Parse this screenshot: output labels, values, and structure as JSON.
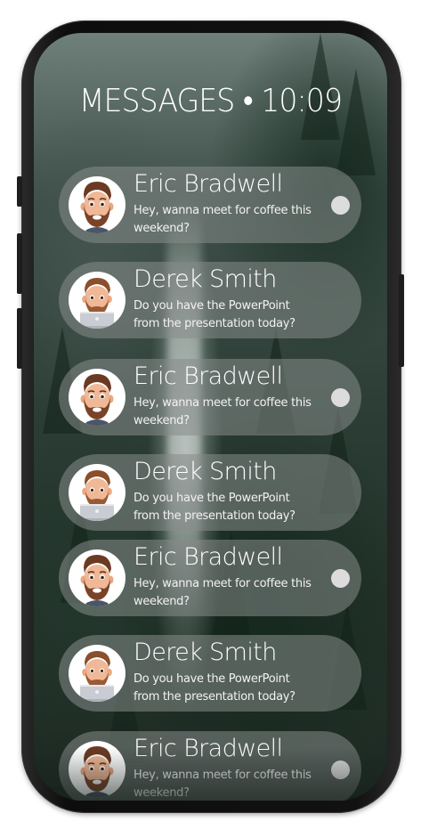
{
  "header": {
    "title": "MESSAGES • 10:09"
  },
  "messages": [
    {
      "sender": "Eric Bradwell",
      "preview": "Hey, wanna meet for coffee this weekend?",
      "avatar": "eric",
      "unread": true
    },
    {
      "sender": "Derek Smith",
      "preview": "Do you have the PowerPoint from the presentation today?",
      "avatar": "derek",
      "unread": false
    },
    {
      "sender": "Eric Bradwell",
      "preview": "Hey, wanna meet for coffee this weekend?",
      "avatar": "eric",
      "unread": true
    },
    {
      "sender": "Derek Smith",
      "preview": "Do you have the PowerPoint from the presentation today?",
      "avatar": "derek",
      "unread": false
    },
    {
      "sender": "Eric Bradwell",
      "preview": "Hey, wanna meet for coffee this weekend?",
      "avatar": "eric",
      "unread": true
    },
    {
      "sender": "Derek Smith",
      "preview": "Do you have the PowerPoint from the presentation today?",
      "avatar": "derek",
      "unread": false
    },
    {
      "sender": "Eric Bradwell",
      "preview": "Hey, wanna meet for coffee this weekend?",
      "avatar": "eric",
      "unread": true
    }
  ],
  "colors": {
    "card": "#878a8a",
    "text": "#ffffff",
    "unread_dot": "#dcdcdc"
  }
}
